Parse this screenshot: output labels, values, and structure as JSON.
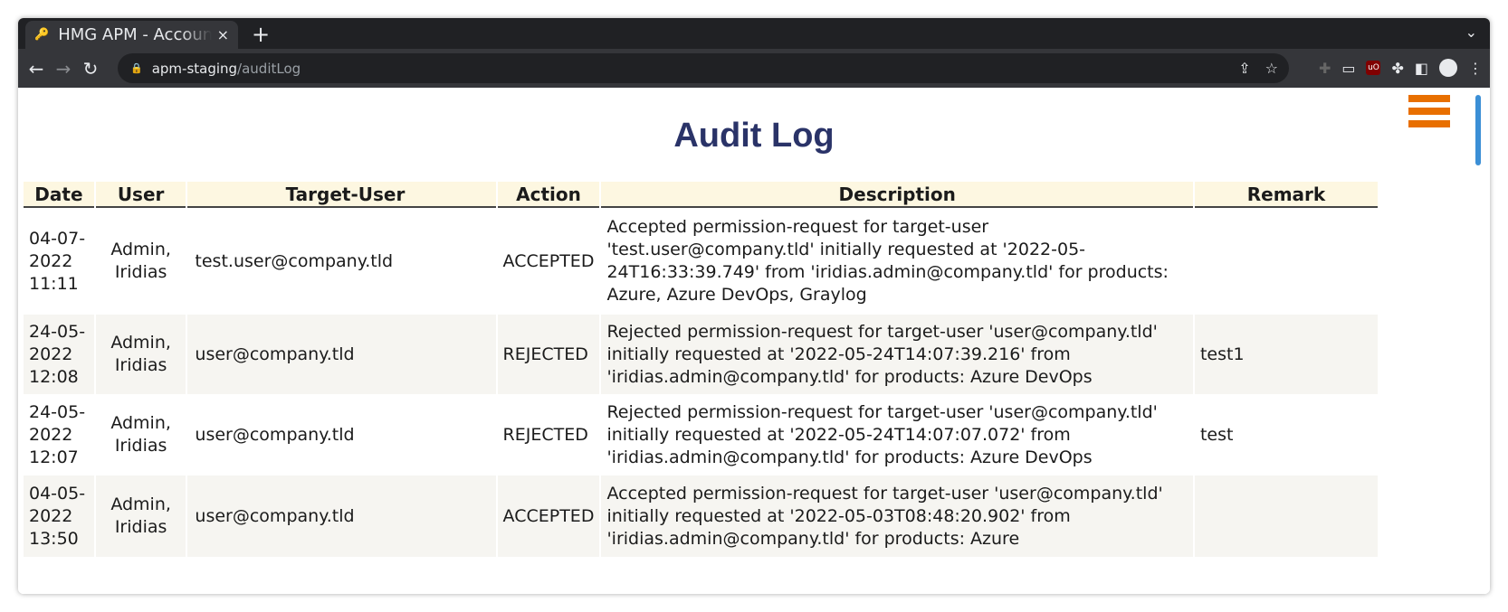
{
  "browser": {
    "tab_title": "HMG APM - Accounts",
    "tab_close": "×",
    "new_tab": "+",
    "url_host": "apm-staging",
    "url_path": " /auditLog"
  },
  "page": {
    "title": "Audit Log"
  },
  "table": {
    "headers": {
      "date": "Date",
      "user": "User",
      "target": "Target-User",
      "action": "Action",
      "description": "Description",
      "remark": "Remark"
    },
    "rows": [
      {
        "date": "04-07-2022 11:11",
        "user": "Admin, Iridias",
        "target": "test.user@company.tld",
        "action": "ACCEPTED",
        "description": "Accepted permission-request for target-user 'test.user@company.tld' initially requested at '2022-05-24T16:33:39.749' from 'iridias.admin@company.tld' for products: Azure, Azure DevOps, Graylog",
        "remark": ""
      },
      {
        "date": "24-05-2022 12:08",
        "user": "Admin, Iridias",
        "target": "user@company.tld",
        "action": "REJECTED",
        "description": "Rejected permission-request for target-user 'user@company.tld' initially requested at '2022-05-24T14:07:39.216' from 'iridias.admin@company.tld' for products: Azure DevOps",
        "remark": "test1"
      },
      {
        "date": "24-05-2022 12:07",
        "user": "Admin, Iridias",
        "target": "user@company.tld",
        "action": "REJECTED",
        "description": "Rejected permission-request for target-user 'user@company.tld' initially requested at '2022-05-24T14:07:07.072' from 'iridias.admin@company.tld' for products: Azure DevOps",
        "remark": "test"
      },
      {
        "date": "04-05-2022 13:50",
        "user": "Admin, Iridias",
        "target": "user@company.tld",
        "action": "ACCEPTED",
        "description": "Accepted permission-request for target-user 'user@company.tld' initially requested at '2022-05-03T08:48:20.902' from 'iridias.admin@company.tld' for products: Azure",
        "remark": ""
      }
    ]
  }
}
